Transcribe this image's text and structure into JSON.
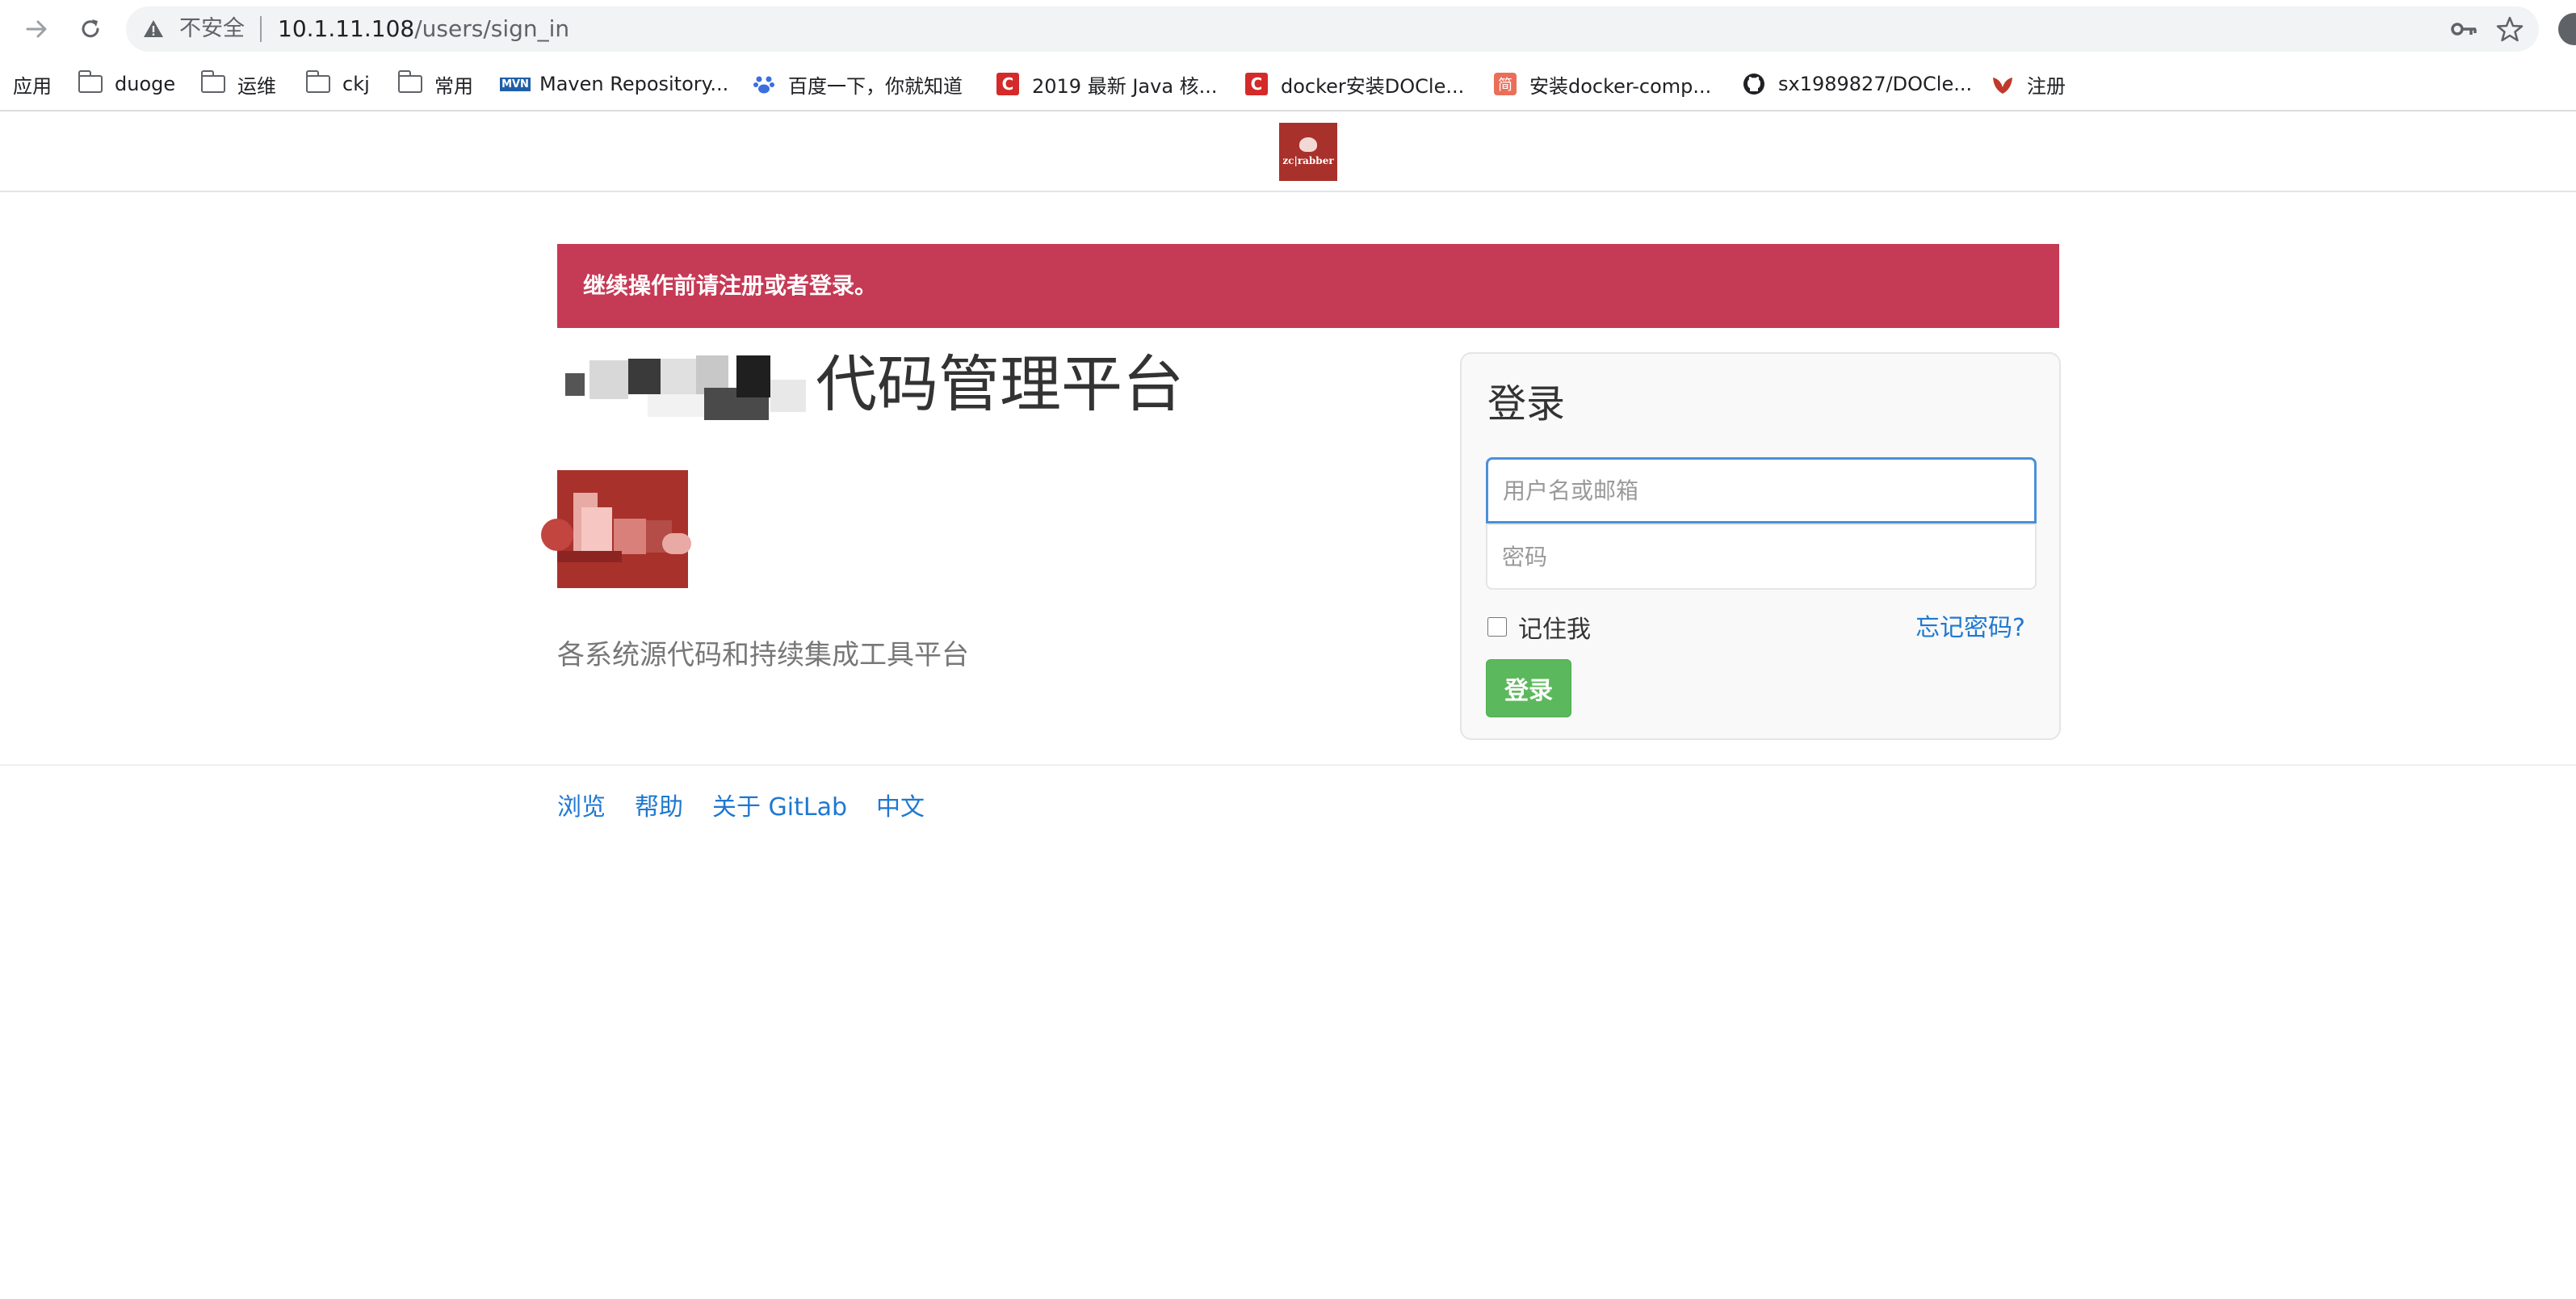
{
  "browser": {
    "security_label": "不安全",
    "url_host": "10.1.11.108",
    "url_path": "/users/sign_in"
  },
  "bookmarks": [
    {
      "label": "应用",
      "icon": "apps-icon"
    },
    {
      "label": "duoge",
      "icon": "folder-icon"
    },
    {
      "label": "运维",
      "icon": "folder-icon"
    },
    {
      "label": "ckj",
      "icon": "folder-icon"
    },
    {
      "label": "常用",
      "icon": "folder-icon"
    },
    {
      "label": "Maven Repository...",
      "icon": "mvn-icon",
      "icon_text": "MVN"
    },
    {
      "label": "百度一下，你就知道",
      "icon": "baidu-paw-icon"
    },
    {
      "label": "2019 最新 Java 核...",
      "icon": "csdn-icon",
      "icon_text": "C"
    },
    {
      "label": "docker安装DOCle...",
      "icon": "csdn-icon",
      "icon_text": "C"
    },
    {
      "label": "安装docker-comp...",
      "icon": "jianshu-icon",
      "icon_text": "简"
    },
    {
      "label": "sx1989827/DOCle...",
      "icon": "github-icon"
    },
    {
      "label": "注册",
      "icon": "leaf-icon"
    }
  ],
  "header": {
    "logo_text": "zc|rabber"
  },
  "alert": {
    "message": "继续操作前请注册或者登录。"
  },
  "main": {
    "title_visible": "代码管理平台",
    "tagline": "各系统源代码和持续集成工具平台"
  },
  "login": {
    "title": "登录",
    "username_placeholder": "用户名或邮箱",
    "password_placeholder": "密码",
    "remember_label": "记住我",
    "forgot_label": "忘记密码?",
    "submit_label": "登录"
  },
  "footer": {
    "links": [
      "浏览",
      "帮助",
      "关于 GitLab",
      "中文"
    ]
  },
  "colors": {
    "alert_bg": "#c53a55",
    "button_green": "#5cb85c",
    "link_blue": "#1f78d1",
    "brand_red": "#a8312c"
  }
}
